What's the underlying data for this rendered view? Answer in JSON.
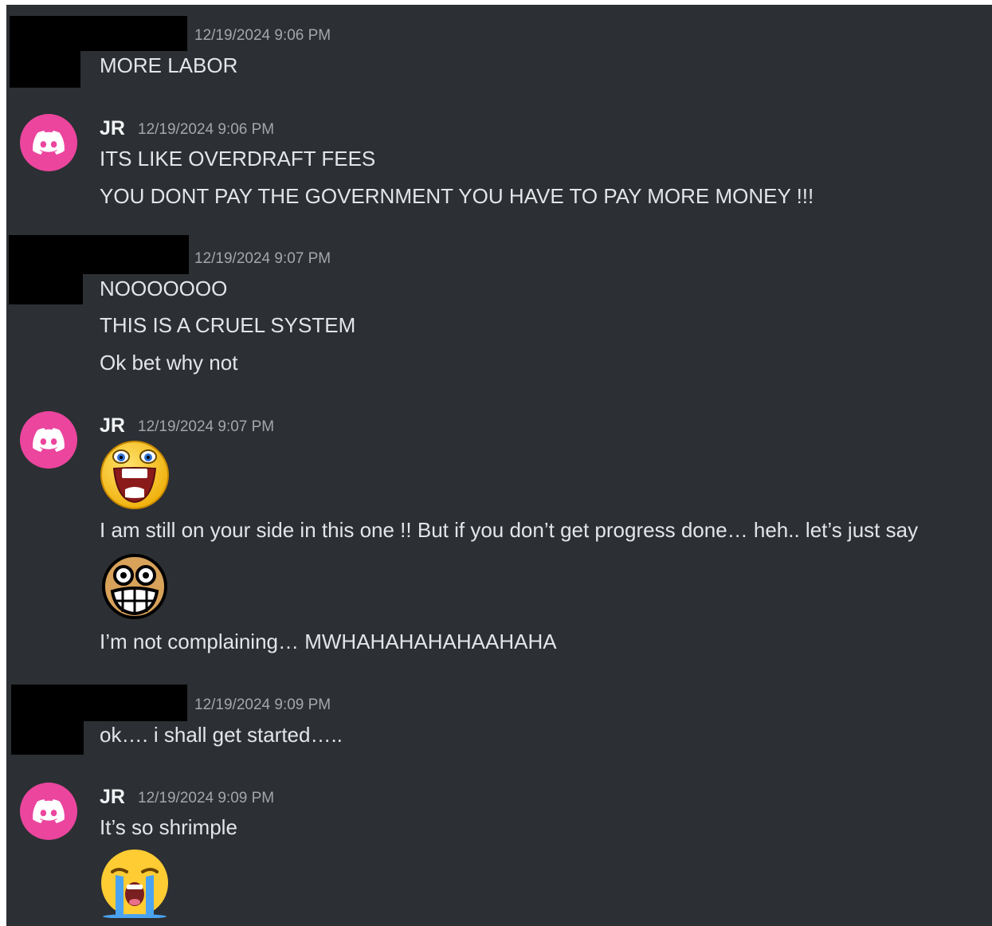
{
  "messages": [
    {
      "author": "",
      "timestamp": "12/19/2024 9:06 PM",
      "lines": [
        "MORE LABOR"
      ]
    },
    {
      "author": "JR",
      "avatar_icon": "discord-logo-icon",
      "avatar_color": "#eb459e",
      "timestamp": "12/19/2024 9:06 PM",
      "lines": [
        "ITS LIKE OVERDRAFT FEES",
        "YOU DONT PAY THE GOVERNMENT YOU HAVE TO PAY MORE MONEY !!!"
      ]
    },
    {
      "author": "",
      "timestamp": "12/19/2024 9:07 PM",
      "lines": [
        "NOOOOOOO",
        "THIS IS A CRUEL SYSTEM",
        "Ok bet why not"
      ]
    },
    {
      "author": "JR",
      "avatar_icon": "discord-logo-icon",
      "avatar_color": "#eb459e",
      "timestamp": "12/19/2024 9:07 PM",
      "emoji_1": "laughing-face-emoji",
      "lines": [
        "I am still on your side in this one !! But if you don’t get progress done… heh.. let’s just say",
        "I’m not complaining… MWHAHAHAHAHAAHAHA"
      ],
      "emoji_2": "grinning-nerd-face-emoji"
    },
    {
      "author": "",
      "timestamp": "12/19/2024 9:09 PM",
      "lines": [
        "ok…. i shall get started….."
      ]
    },
    {
      "author": "JR",
      "avatar_icon": "discord-logo-icon",
      "avatar_color": "#eb459e",
      "timestamp": "12/19/2024 9:09 PM",
      "lines": [
        "It’s so shrimple"
      ],
      "emoji_1": "loudly-crying-face-emoji"
    }
  ],
  "colors": {
    "background": "#2c2f33",
    "text": "#e3e5e8",
    "timestamp": "#a3a6aa",
    "redaction": "#000000"
  }
}
